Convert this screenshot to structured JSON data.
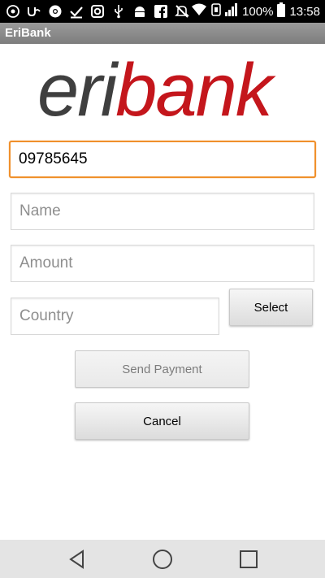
{
  "status_bar": {
    "battery_percent": "100%",
    "time": "13:58",
    "icons": [
      "whatsapp-icon",
      "upwork-icon",
      "chrome-icon",
      "check-icon",
      "instagram-icon",
      "usb-icon",
      "android-debug-icon",
      "facebook-icon",
      "mute-icon",
      "wifi-icon",
      "lte-icon",
      "signal-icon",
      "battery-icon"
    ]
  },
  "app": {
    "title": "EriBank",
    "logo_text_part1": "eri",
    "logo_text_part2": "bank",
    "colors": {
      "logo_gray": "#3f3f3f",
      "logo_red": "#c4161c",
      "focus_border": "#f0902b"
    }
  },
  "form": {
    "phone": {
      "value": "09785645",
      "placeholder": ""
    },
    "name": {
      "value": "",
      "placeholder": "Name"
    },
    "amount": {
      "value": "",
      "placeholder": "Amount"
    },
    "country": {
      "value": "",
      "placeholder": "Country"
    },
    "select_label": "Select",
    "send_label": "Send Payment",
    "cancel_label": "Cancel"
  },
  "navbar": {
    "icons": [
      "back-icon",
      "home-icon",
      "recents-icon"
    ]
  }
}
